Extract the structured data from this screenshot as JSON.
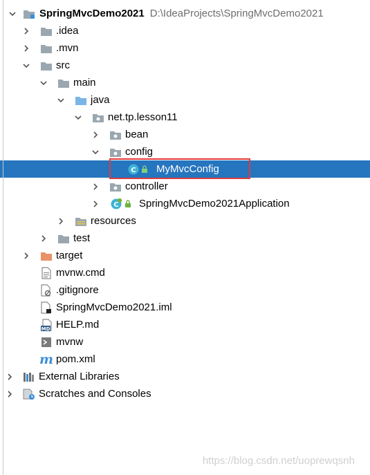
{
  "project": {
    "name": "SpringMvcDemo2021",
    "path": "D:\\IdeaProjects\\SpringMvcDemo2021"
  },
  "tree": {
    "idea": ".idea",
    "mvn": ".mvn",
    "src": "src",
    "main": "main",
    "java": "java",
    "package": "net.tp.lesson11",
    "bean": "bean",
    "config": "config",
    "mymvcconfig": "MyMvcConfig",
    "controller": "controller",
    "application": "SpringMvcDemo2021Application",
    "resources": "resources",
    "test": "test",
    "target": "target",
    "mvnw_cmd": "mvnw.cmd",
    "gitignore": ".gitignore",
    "iml": "SpringMvcDemo2021.iml",
    "help": "HELP.md",
    "mvnw": "mvnw",
    "pom": "pom.xml",
    "external": "External Libraries",
    "scratches": "Scratches and Consoles"
  },
  "icons": {
    "md_badge": "MD",
    "class_badge": "C",
    "maven_glyph": "m"
  },
  "watermark": "https://blog.csdn.net/uoprewqsnh",
  "colors": {
    "selection": "#2675bf",
    "highlight_border": "#e03a3a",
    "folder": "#9aa7b0",
    "source_folder": "#7ab5e6",
    "target_folder": "#e8926a",
    "spring_green": "#6db33f"
  }
}
